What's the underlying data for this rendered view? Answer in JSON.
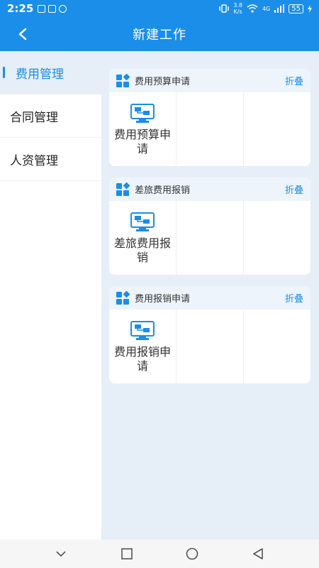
{
  "status_bar": {
    "time": "2:25",
    "speed_top": "3.8",
    "speed_bottom": "K/s",
    "network": "4G",
    "battery": "55"
  },
  "header": {
    "title": "新建工作"
  },
  "sidebar": {
    "items": [
      {
        "label": "费用管理"
      },
      {
        "label": "合同管理"
      },
      {
        "label": "人资管理"
      }
    ]
  },
  "sections": [
    {
      "title": "费用预算申请",
      "collapse": "折叠",
      "app_label": "费用预算申请"
    },
    {
      "title": "差旅费用报销",
      "collapse": "折叠",
      "app_label": "差旅费用报销"
    },
    {
      "title": "费用报销申请",
      "collapse": "折叠",
      "app_label": "费用报销申请"
    }
  ],
  "colors": {
    "accent": "#1a8ee8",
    "background": "#e6eef8"
  }
}
